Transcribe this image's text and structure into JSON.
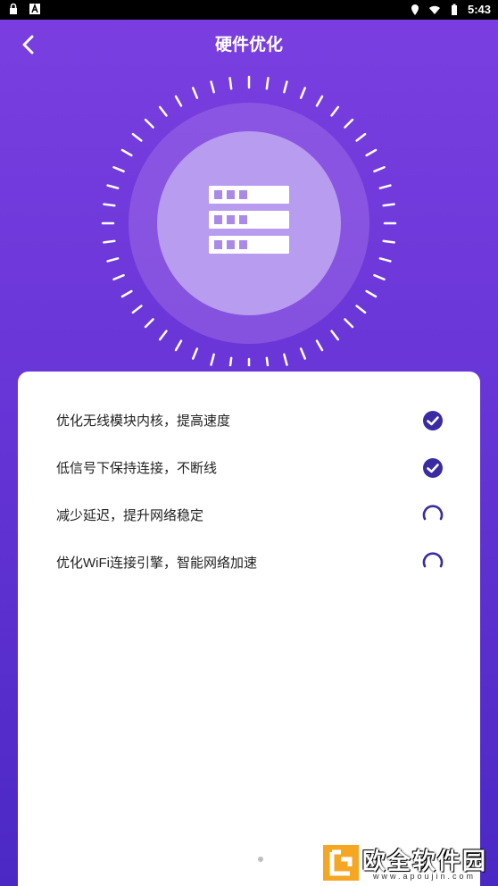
{
  "status_bar": {
    "time": "5:43",
    "left_icons": [
      "lock-icon",
      "a-icon"
    ],
    "right_icons": [
      "location-icon",
      "wifi-icon",
      "battery-icon"
    ]
  },
  "header": {
    "title": "硬件优化",
    "back_icon": "chevron-left-icon"
  },
  "gauge": {
    "center_icon": "server-rack-icon"
  },
  "tasks": [
    {
      "label": "优化无线模块内核，提高速度",
      "status": "done"
    },
    {
      "label": "低信号下保持连接，不断线",
      "status": "done"
    },
    {
      "label": "减少延迟，提升网络稳定",
      "status": "loading"
    },
    {
      "label": "优化WiFi连接引擎，智能网络加速",
      "status": "loading"
    }
  ],
  "watermark": {
    "text": "欧全软件园",
    "url": "www.apoujin.com"
  },
  "colors": {
    "primary": "#6a36d8",
    "accent": "#3a2ba3",
    "card": "#ffffff"
  }
}
